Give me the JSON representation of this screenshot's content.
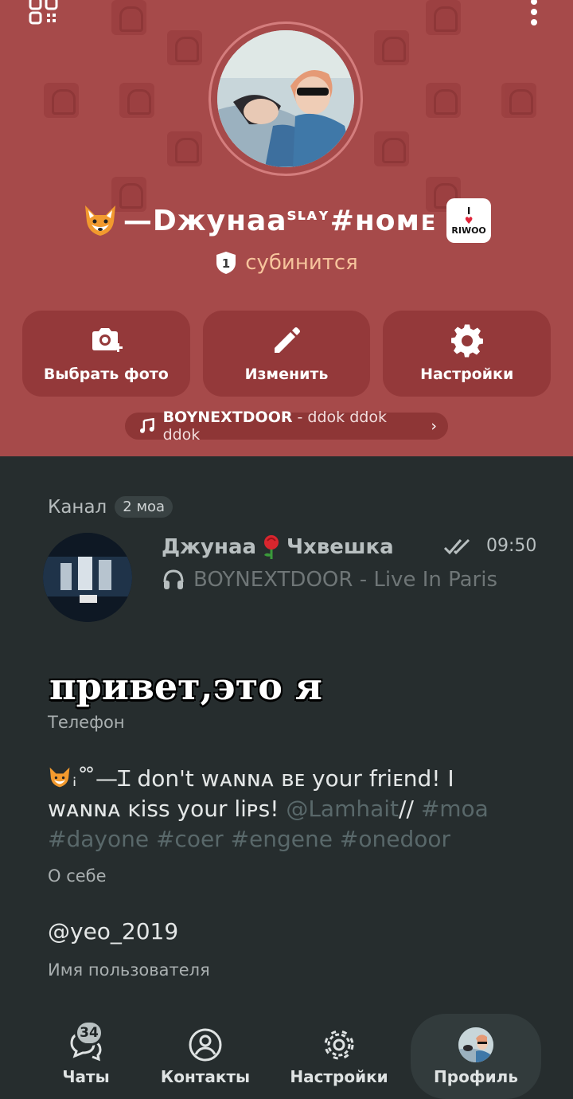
{
  "profile": {
    "name": "—Dжунаа",
    "name_sup": "sʟᴀʏ",
    "name_tag": "#ʜᴏᴍᴇ",
    "riwoo_badge": {
      "line1": "I",
      "line2": "RIWOO"
    },
    "status": "субинится",
    "shield_num": "1"
  },
  "actions": [
    {
      "label": "Выбрать фото",
      "icon": "camera-plus-icon"
    },
    {
      "label": "Изменить",
      "icon": "pencil-icon"
    },
    {
      "label": "Настройки",
      "icon": "gear-icon"
    }
  ],
  "music": {
    "artist": "BOYNEXTDOOR",
    "song": " - ddok ddok ddok",
    "chevron": "›"
  },
  "channel": {
    "label": "Канал",
    "badge": "2 моа",
    "name_left": "Джунаа",
    "name_right": "Чхвешка",
    "time": "09:50",
    "subtitle": "BOYNEXTDOOR - Live In Paris"
  },
  "overlay_text": "привет,это я",
  "phone_label": "Телефон",
  "bio": {
    "text_main": "ꜟ˚ ̊—Ɪ don't ᴡᴀɴɴᴀ ʙᴇ your friᴇnd! I ᴡᴀɴɴᴀ ᴋiss your liᴘs! ",
    "mention": "@Lamhait",
    "slashes": "// ",
    "tags": "#moa #dayone #coer #engene #onedoor",
    "label": "О себе"
  },
  "username": {
    "value": "@yeo_2019",
    "label": "Имя пользователя"
  },
  "nav": {
    "chats": "Чаты",
    "chats_badge": "34",
    "contacts": "Контакты",
    "settings": "Настройки",
    "profile": "Профиль"
  },
  "colors": {
    "header_bg": "#a64a4a",
    "content_bg": "#262d2e",
    "accent_status": "#f6c49c"
  }
}
